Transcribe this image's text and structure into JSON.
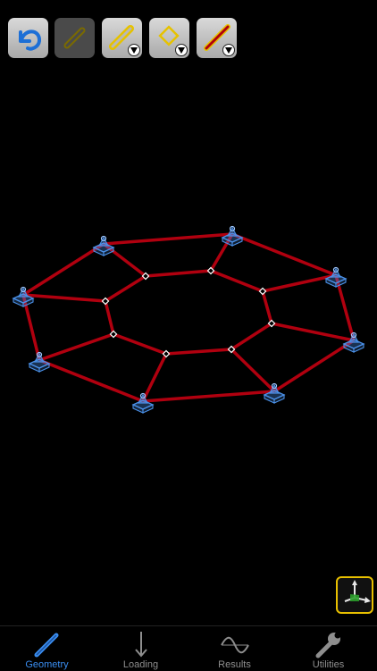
{
  "toolbar": {
    "buttons": [
      {
        "name": "undo-button",
        "icon": "undo-arrow-icon",
        "enabled": true
      },
      {
        "name": "link-button",
        "icon": "member-link-icon",
        "enabled": false
      },
      {
        "name": "member-tool-button",
        "icon": "member-pencil-icon",
        "enabled": true,
        "dropdown": true
      },
      {
        "name": "node-tool-button",
        "icon": "node-diamond-icon",
        "enabled": true,
        "dropdown": true
      },
      {
        "name": "section-tool-button",
        "icon": "section-bar-icon",
        "enabled": true,
        "dropdown": true
      }
    ]
  },
  "model": {
    "member_color": "#b0000f",
    "support_color": "#4a90e8",
    "supports_count": 8,
    "nodes_count": 8
  },
  "tabs": [
    {
      "label": "Geometry",
      "icon": "geometry-pencil-icon",
      "active": true
    },
    {
      "label": "Loading",
      "icon": "loading-arrow-icon",
      "active": false
    },
    {
      "label": "Results",
      "icon": "results-wave-icon",
      "active": false
    },
    {
      "label": "Utilities",
      "icon": "utilities-wrench-icon",
      "active": false
    }
  ],
  "colors": {
    "accent": "#3a8df0",
    "highlight": "#e8c000",
    "background": "#000000"
  }
}
